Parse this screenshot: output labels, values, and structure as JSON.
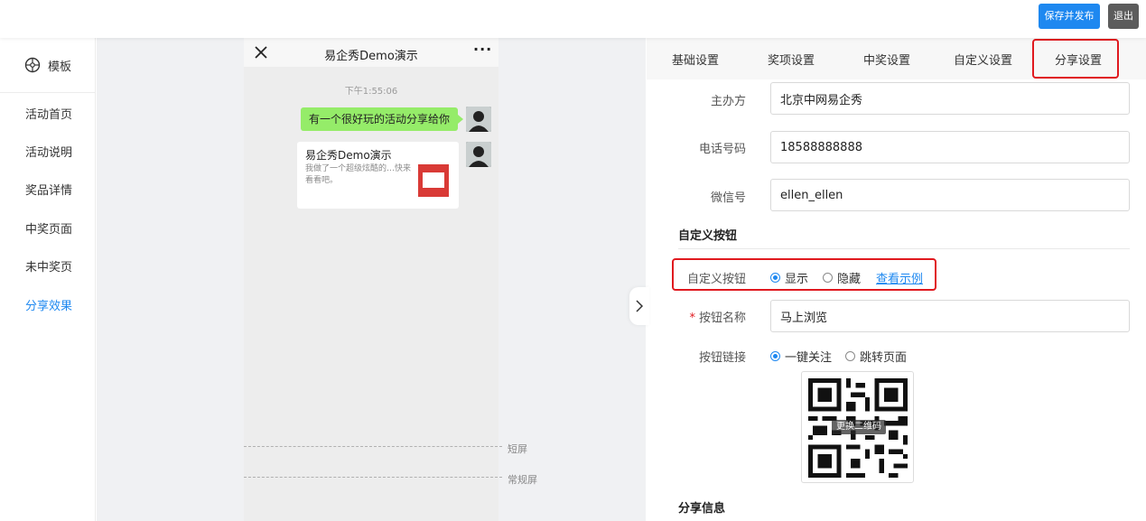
{
  "toolbar": {
    "publish_label": "保存并发布",
    "exit_label": "退出"
  },
  "sidebar": {
    "header_label": "模板",
    "items": [
      {
        "label": "活动首页"
      },
      {
        "label": "活动说明"
      },
      {
        "label": "奖品详情"
      },
      {
        "label": "中奖页面"
      },
      {
        "label": "未中奖页"
      },
      {
        "label": "分享效果",
        "active": true
      }
    ]
  },
  "preview": {
    "title": "易企秀Demo演示",
    "time": "下午1:55:06",
    "bubble_text": "有一个很好玩的活动分享给你",
    "card": {
      "title": "易企秀Demo演示",
      "desc": "我做了一个超级炫酷的…快来看看吧。"
    },
    "guide_short": "短屏",
    "guide_normal": "常规屏"
  },
  "tabs": [
    {
      "label": "基础设置"
    },
    {
      "label": "奖项设置"
    },
    {
      "label": "中奖设置"
    },
    {
      "label": "自定义设置"
    },
    {
      "label": "分享设置",
      "active": true
    }
  ],
  "form": {
    "organizer_label": "主办方",
    "organizer_value": "北京中网易企秀",
    "phone_label": "电话号码",
    "phone_value": "18588888888",
    "wechat_label": "微信号",
    "wechat_value": "ellen_ellen",
    "custom_section": "自定义按钮",
    "custom_btn_label": "自定义按钮",
    "show_label": "显示",
    "hide_label": "隐藏",
    "example_link": "查看示例",
    "btn_name_label": "按钮名称",
    "btn_name_value": "马上浏览",
    "btn_link_label": "按钮链接",
    "follow_label": "一键关注",
    "jump_label": "跳转页面",
    "replace_qr_label": "更换二维码",
    "share_section": "分享信息"
  },
  "colors": {
    "accent": "#1e88f0",
    "highlight": "#e0191f",
    "bubble": "#95ec69"
  }
}
